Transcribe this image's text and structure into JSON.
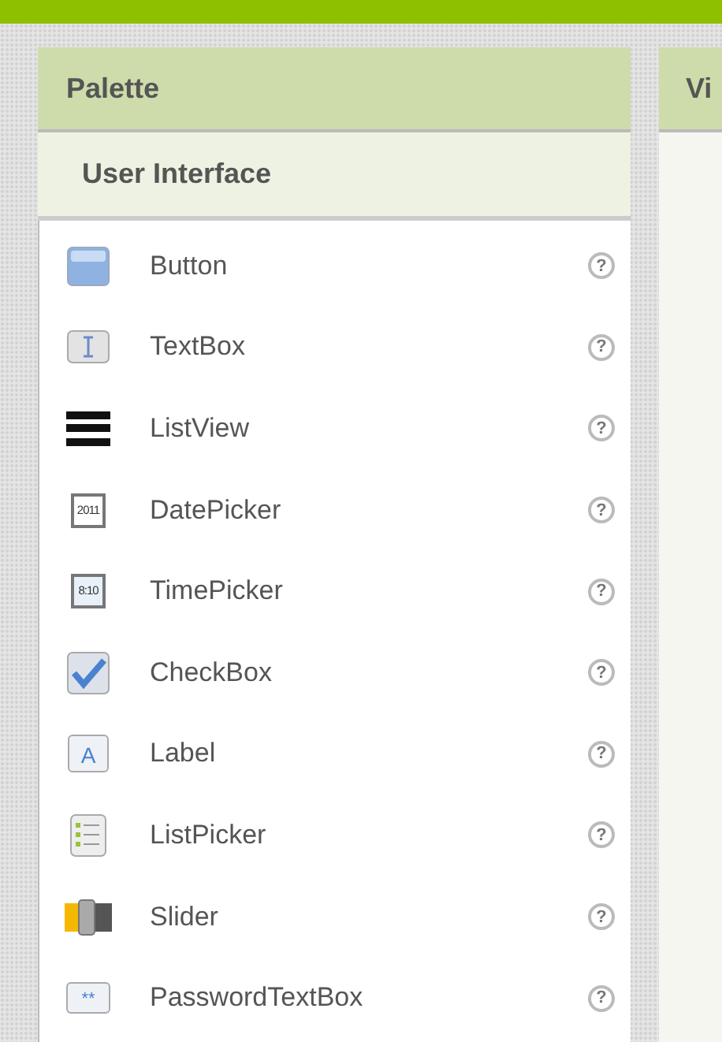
{
  "palette": {
    "title": "Palette",
    "category": "User Interface",
    "items": [
      {
        "label": "Button",
        "kind": "button",
        "help": "?"
      },
      {
        "label": "TextBox",
        "kind": "textbox",
        "help": "?"
      },
      {
        "label": "ListView",
        "kind": "listview",
        "help": "?"
      },
      {
        "label": "DatePicker",
        "kind": "datepicker",
        "icon_text": "2011",
        "help": "?"
      },
      {
        "label": "TimePicker",
        "kind": "timepicker",
        "icon_text": "8:10",
        "help": "?"
      },
      {
        "label": "CheckBox",
        "kind": "checkbox",
        "help": "?"
      },
      {
        "label": "Label",
        "kind": "label",
        "icon_text": "A",
        "help": "?"
      },
      {
        "label": "ListPicker",
        "kind": "listpicker",
        "help": "?"
      },
      {
        "label": "Slider",
        "kind": "slider",
        "help": "?"
      },
      {
        "label": "PasswordTextBox",
        "kind": "password",
        "icon_text": "**",
        "help": "?"
      }
    ]
  },
  "viewer": {
    "title": "Vi"
  }
}
